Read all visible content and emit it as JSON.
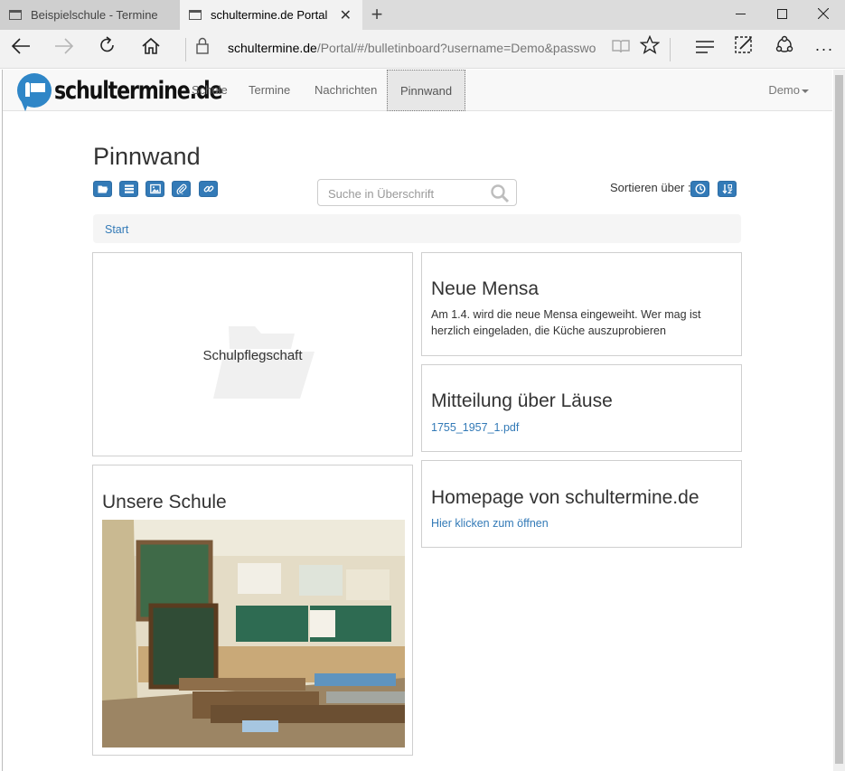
{
  "browser": {
    "tabs": [
      {
        "title": "Beispielschule - Termine",
        "active": false
      },
      {
        "title": "schultermine.de Portal",
        "active": true
      }
    ],
    "url_host": "schultermine.de",
    "url_path": "/Portal/#/bulletinboard?username=Demo&password=D"
  },
  "site": {
    "logo_text": "schultermine.de",
    "nav": [
      {
        "label": "Schule",
        "active": false
      },
      {
        "label": "Termine",
        "active": false
      },
      {
        "label": "Nachrichten",
        "active": false
      },
      {
        "label": "Pinnwand",
        "active": true
      }
    ],
    "user_menu": "Demo"
  },
  "page": {
    "title": "Pinnwand",
    "toolbar_icons": [
      "folder-open-icon",
      "list-icon",
      "image-icon",
      "paperclip-icon",
      "link-icon"
    ],
    "search_placeholder": "Suche in Überschrift",
    "sort_label": "Sortieren über :",
    "sort_icons": [
      "clock-icon",
      "sort-alpha-icon"
    ],
    "breadcrumb": "Start"
  },
  "board": {
    "folder": {
      "name": "Schulpflegschaft"
    },
    "school_card": {
      "title": "Unsere Schule"
    },
    "mensa": {
      "title": "Neue Mensa",
      "text_line1": "Am 1.4. wird die neue Mensa eingeweiht. Wer mag ist",
      "text_line2": "herzlich eingeladen, die Küche auszuprobieren"
    },
    "laeuse": {
      "title": "Mitteilung über Läuse",
      "attachment": "1755_1957_1.pdf"
    },
    "homepage": {
      "title": "Homepage von schultermine.de",
      "link": "Hier klicken zum öffnen"
    }
  },
  "colors": {
    "primary": "#337ab7",
    "link": "#337ab7",
    "nav_bg": "#f8f8f8"
  }
}
